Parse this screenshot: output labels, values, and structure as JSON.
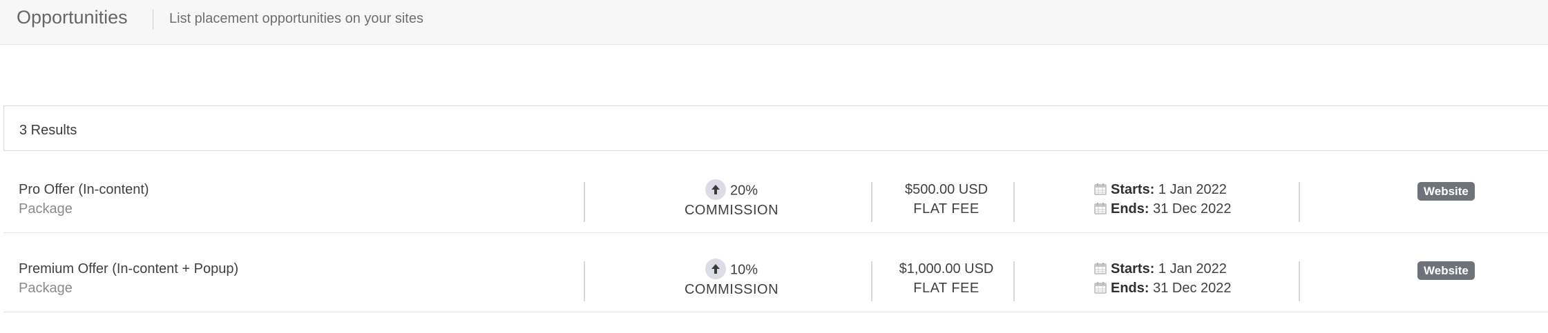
{
  "header": {
    "title": "Opportunities",
    "subtitle": "List placement opportunities on your sites"
  },
  "results": {
    "count_label": "3 Results"
  },
  "opportunities": [
    {
      "name": "Pro Offer (In-content)",
      "type": "Package",
      "commission_percent": "20%",
      "commission_label": "COMMISSION",
      "fee_amount": "$500.00 USD",
      "fee_label": "FLAT FEE",
      "starts_label": "Starts:",
      "starts_date": "1 Jan 2022",
      "ends_label": "Ends:",
      "ends_date": "31 Dec 2022",
      "badge": "Website"
    },
    {
      "name": "Premium Offer (In-content + Popup)",
      "type": "Package",
      "commission_percent": "10%",
      "commission_label": "COMMISSION",
      "fee_amount": "$1,000.00 USD",
      "fee_label": "FLAT FEE",
      "starts_label": "Starts:",
      "starts_date": "1 Jan 2022",
      "ends_label": "Ends:",
      "ends_date": "31 Dec 2022",
      "badge": "Website"
    }
  ],
  "icons": {
    "commission": "arrow-up-icon",
    "date": "calendar-icon"
  },
  "colors": {
    "badge_bg": "#6d7378",
    "arrow_circle": "#dcdce6",
    "header_bg": "#f7f7f7"
  }
}
